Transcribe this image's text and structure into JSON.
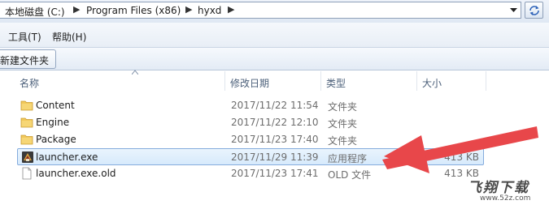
{
  "address_bar": {
    "crumbs": [
      "本地磁盘 (C:)",
      "Program Files (x86)",
      "hyxd"
    ],
    "dropdown_icon": "chevron-down-icon",
    "refresh_icon": "refresh-icon"
  },
  "menu": {
    "tools": "工具(T)",
    "help": "帮助(H)"
  },
  "toolbar": {
    "new_folder": "新建文件夹"
  },
  "columns": {
    "name": "名称",
    "modified": "修改日期",
    "type": "类型",
    "size": "大小"
  },
  "files": [
    {
      "name": "Content",
      "modified": "2017/11/22 11:54",
      "type": "文件夹",
      "size": "",
      "icon": "folder-icon",
      "selected": false
    },
    {
      "name": "Engine",
      "modified": "2017/11/22 12:10",
      "type": "文件夹",
      "size": "",
      "icon": "folder-icon",
      "selected": false
    },
    {
      "name": "Package",
      "modified": "2017/11/23 17:40",
      "type": "文件夹",
      "size": "",
      "icon": "folder-icon",
      "selected": false
    },
    {
      "name": "launcher.exe",
      "modified": "2017/11/29 11:39",
      "type": "应用程序",
      "size": "413 KB",
      "icon": "launcher-app-icon",
      "selected": true
    },
    {
      "name": "launcher.exe.old",
      "modified": "2017/11/23 17:41",
      "type": "OLD 文件",
      "size": "413 KB",
      "icon": "blank-file-icon",
      "selected": false
    }
  ],
  "colors": {
    "selection_bg": "#d7eafc",
    "selection_border": "#84acdd",
    "arrow": "#e8474a",
    "folder": "#f1c85a"
  },
  "watermark": {
    "title": "飞翔下载",
    "url": "www.52z.com"
  }
}
